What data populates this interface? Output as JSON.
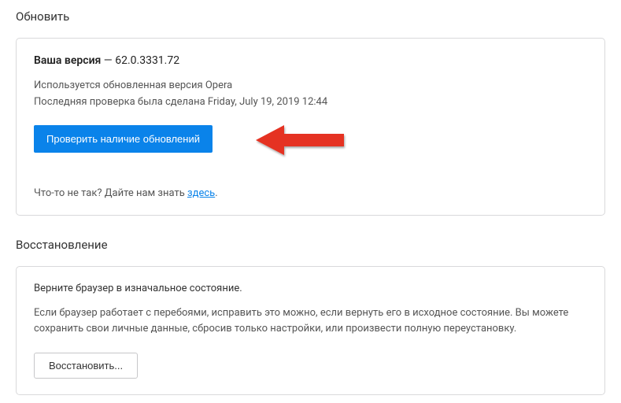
{
  "update": {
    "heading": "Обновить",
    "version_label": "Ваша версия",
    "version_separator": " — ",
    "version_number": "62.0.3331.72",
    "status_line1": "Используется обновленная версия Opera",
    "status_line2": "Последняя проверка была сделана Friday, July 19, 2019 12:44",
    "check_button": "Проверить наличие обновлений",
    "feedback_prefix": "Что-то не так? Дайте нам знать ",
    "feedback_link": "здесь",
    "feedback_suffix": "."
  },
  "recovery": {
    "heading": "Восстановление",
    "title": "Верните браузер в изначальное состояние.",
    "description": "Если браузер работает с перебоями, исправить это можно, если вернуть его в исходное состояние. Вы можете сохранить свои личные данные, сбросив только настройки, или произвести полную переустановку.",
    "button": "Восстановить..."
  },
  "colors": {
    "primary": "#0a83ea",
    "arrow": "#e53323"
  }
}
